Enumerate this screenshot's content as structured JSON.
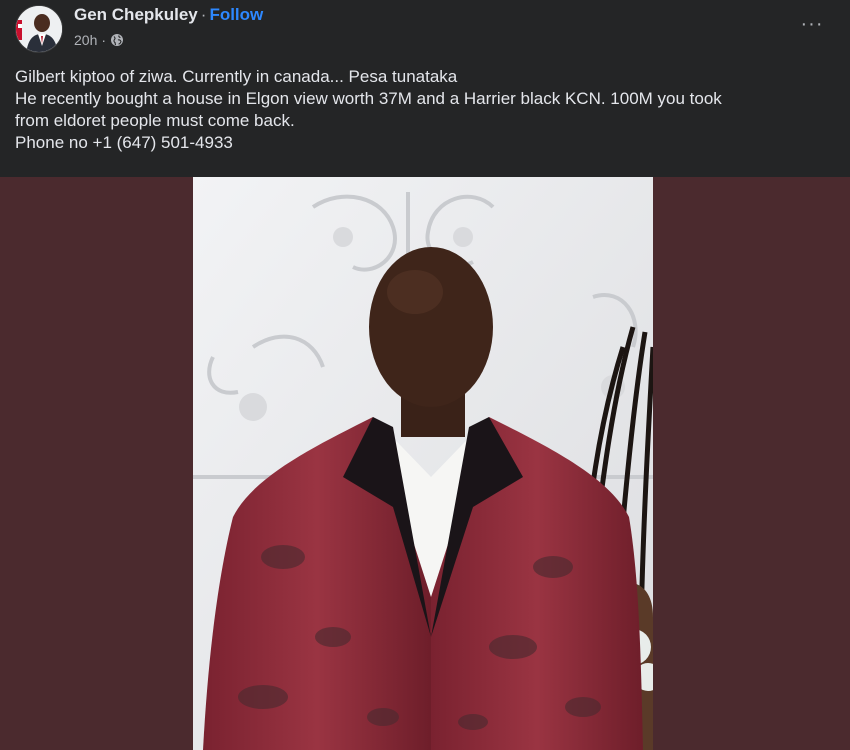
{
  "post": {
    "author": "Gen Chepkuley",
    "separator": "·",
    "follow_label": "Follow",
    "time": "20h",
    "time_separator": "·",
    "privacy_icon": "globe-icon",
    "more_icon": "ellipsis-icon",
    "more_label": "···",
    "text_lines": [
      "Gilbert kiptoo of ziwa. Currently in canada... Pesa tunataka",
      "He recently bought a house in Elgon view worth 37M and a Harrier black KCN. 100M you took",
      "from eldoret people must come back.",
      "Phone no +1 (647) 501-4933"
    ]
  },
  "colors": {
    "background": "#242526",
    "text": "#e4e6eb",
    "secondary_text": "#b0b3b8",
    "link": "#2d88ff",
    "media_letterbox": "#4b2a2e"
  }
}
